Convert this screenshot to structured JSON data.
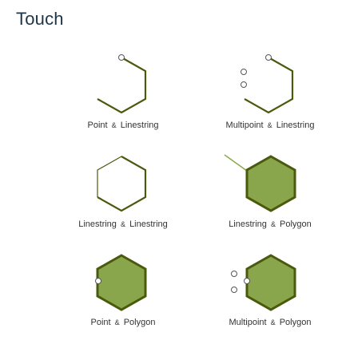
{
  "title": "Touch",
  "colors": {
    "line": "#4a5a0c",
    "polygon_fill": "#8aa64d",
    "polygon_stroke": "#4a5a0c",
    "point_stroke": "#555555",
    "point_fill": "#ffffff",
    "title": "#1e3547",
    "caption": "#333333"
  },
  "panels": [
    {
      "label_a": "Point",
      "amp": "&",
      "label_b": "Linestring"
    },
    {
      "label_a": "Multipoint",
      "amp": "&",
      "label_b": "Linestring"
    },
    {
      "label_a": "Linestring",
      "amp": "&",
      "label_b": "Linestring"
    },
    {
      "label_a": "Linestring",
      "amp": "&",
      "label_b": "Polygon"
    },
    {
      "label_a": "Point",
      "amp": "&",
      "label_b": "Polygon"
    },
    {
      "label_a": "Multipoint",
      "amp": "&",
      "label_b": "Polygon"
    }
  ]
}
